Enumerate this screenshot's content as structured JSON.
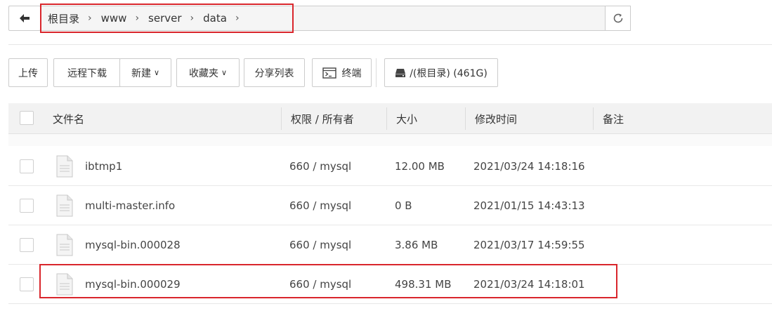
{
  "pathbar": {
    "back_icon": "arrow-left-icon",
    "crumbs": [
      "根目录",
      "www",
      "server",
      "data"
    ],
    "separator": "›",
    "refresh_icon": "refresh-icon"
  },
  "toolbar": {
    "upload": "上传",
    "remote_download": "远程下载",
    "new": "新建",
    "favorites": "收藏夹",
    "share_list": "分享列表",
    "terminal": "终端",
    "disk": "/(根目录) (461G)"
  },
  "table": {
    "headers": {
      "name": "文件名",
      "perm": "权限 / 所有者",
      "size": "大小",
      "mtime": "修改时间",
      "note": "备注"
    },
    "rows": [
      {
        "name": "ibtmp1",
        "perm": "660 / mysql",
        "size": "12.00 MB",
        "mtime": "2021/03/24 14:18:16"
      },
      {
        "name": "multi-master.info",
        "perm": "660 / mysql",
        "size": "0 B",
        "mtime": "2021/01/15 14:43:13"
      },
      {
        "name": "mysql-bin.000028",
        "perm": "660 / mysql",
        "size": "3.86 MB",
        "mtime": "2021/03/17 14:59:55"
      },
      {
        "name": "mysql-bin.000029",
        "perm": "660 / mysql",
        "size": "498.31 MB",
        "mtime": "2021/03/24 14:18:01"
      }
    ]
  },
  "colors": {
    "highlight": "#d9262c"
  }
}
